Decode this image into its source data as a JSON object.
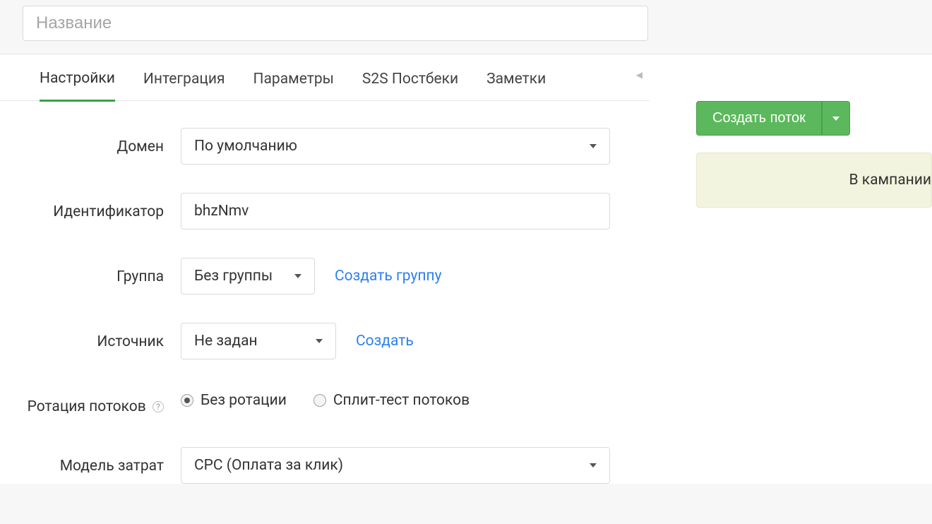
{
  "header": {
    "name_placeholder": "Название"
  },
  "tabs": [
    {
      "label": "Настройки",
      "active": true
    },
    {
      "label": "Интеграция",
      "active": false
    },
    {
      "label": "Параметры",
      "active": false
    },
    {
      "label": "S2S Постбеки",
      "active": false
    },
    {
      "label": "Заметки",
      "active": false
    }
  ],
  "form": {
    "domain": {
      "label": "Домен",
      "value": "По умолчанию"
    },
    "identifier": {
      "label": "Идентификатор",
      "value": "bhzNmv"
    },
    "group": {
      "label": "Группа",
      "value": "Без группы",
      "create_link": "Создать группу"
    },
    "source": {
      "label": "Источник",
      "value": "Не задан",
      "create_link": "Создать"
    },
    "rotation": {
      "label": "Ротация потоков",
      "options": [
        {
          "label": "Без ротации",
          "checked": true
        },
        {
          "label": "Сплит-тест потоков",
          "checked": false
        }
      ]
    },
    "cost_model": {
      "label": "Модель затрат",
      "value": "CPC (Оплата за клик)"
    }
  },
  "sidebar": {
    "create_flow": "Создать поток",
    "notice": "В кампании"
  }
}
